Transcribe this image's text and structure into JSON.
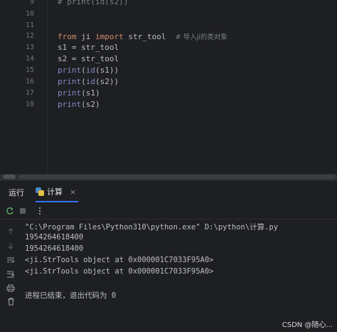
{
  "editor": {
    "lines": [
      {
        "num": "9",
        "code": "# print(id(s2))"
      },
      {
        "num": "10",
        "code": ""
      },
      {
        "num": "11",
        "code": ""
      },
      {
        "num": "12",
        "kw1": "from",
        "mod": " ji ",
        "kw2": "import",
        "name": " str_tool  ",
        "comment": "# 导入ji的类对象"
      },
      {
        "num": "13",
        "code": "s1 = str_tool"
      },
      {
        "num": "14",
        "code": "s2 = str_tool"
      },
      {
        "num": "15",
        "f1": "print",
        "p1": "(",
        "f2": "id",
        "rest": "(s1))"
      },
      {
        "num": "16",
        "f1": "print",
        "p1": "(",
        "f2": "id",
        "rest": "(s2))"
      },
      {
        "num": "17",
        "f1": "print",
        "rest": "(s1)"
      },
      {
        "num": "18",
        "f1": "print",
        "rest": "(s2)"
      }
    ]
  },
  "panel": {
    "tab_run": "运行",
    "tab_file": "计算",
    "tab_close": "×"
  },
  "icons": {
    "rerun": "rerun-icon",
    "stop": "stop-icon",
    "more": "more-vertical-icon",
    "up": "arrow-up-icon",
    "down": "arrow-down-icon",
    "wrap": "soft-wrap-icon",
    "scroll_end": "scroll-to-end-icon",
    "print": "print-icon",
    "trash": "trash-icon"
  },
  "output": {
    "lines": [
      "\"C:\\Program Files\\Python310\\python.exe\" D:\\python\\计算.py",
      "1954264618400",
      "1954264618400",
      "<ji.StrTools object at 0x000001C7033F95A0>",
      "<ji.StrTools object at 0x000001C7033F95A0>",
      "",
      "进程已结束，退出代码为 0"
    ]
  },
  "watermark": "CSDN @随心..."
}
